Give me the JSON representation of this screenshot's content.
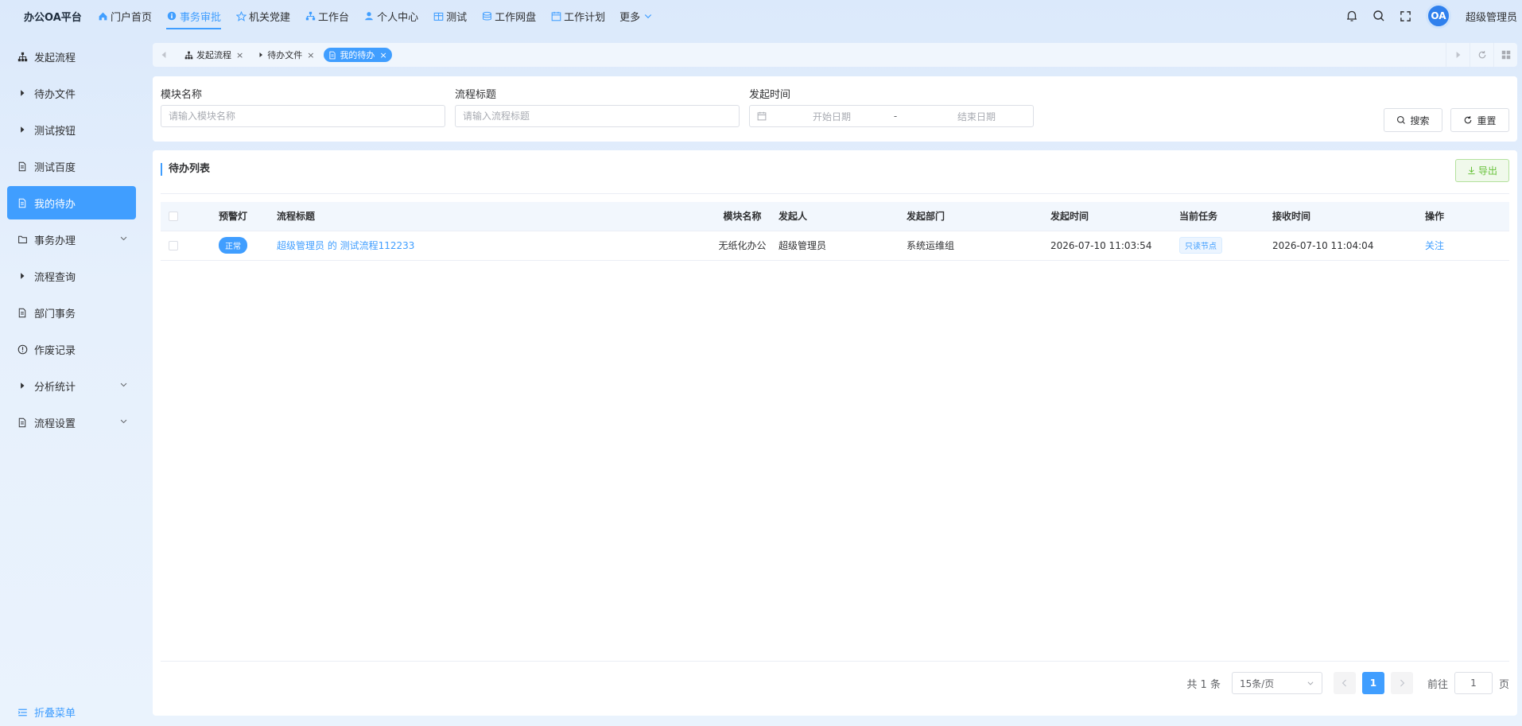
{
  "app": {
    "brand": "办公OA平台",
    "username": "超级管理员",
    "avatar_text": "OA"
  },
  "topnav": [
    {
      "label": "门户首页",
      "icon": "home-icon"
    },
    {
      "label": "事务审批",
      "icon": "info-icon",
      "active": true
    },
    {
      "label": "机关党建",
      "icon": "star-icon"
    },
    {
      "label": "工作台",
      "icon": "workbench-icon"
    },
    {
      "label": "个人中心",
      "icon": "user-icon"
    },
    {
      "label": "测试",
      "icon": "grid-icon"
    },
    {
      "label": "工作网盘",
      "icon": "database-icon"
    },
    {
      "label": "工作计划",
      "icon": "calendar-icon"
    },
    {
      "label": "更多",
      "icon": "chevron-down-icon"
    }
  ],
  "sidebar": {
    "items": [
      {
        "label": "发起流程",
        "icon": "org-chart-icon"
      },
      {
        "label": "待办文件",
        "icon": "caret-right-icon"
      },
      {
        "label": "测试按钮",
        "icon": "caret-right-icon"
      },
      {
        "label": "测试百度",
        "icon": "document-icon"
      },
      {
        "label": "我的待办",
        "icon": "document-icon",
        "active": true
      },
      {
        "label": "事务办理",
        "icon": "folder-icon",
        "expandable": true
      },
      {
        "label": "流程查询",
        "icon": "caret-right-icon"
      },
      {
        "label": "部门事务",
        "icon": "document-icon"
      },
      {
        "label": "作废记录",
        "icon": "info-circle-icon"
      },
      {
        "label": "分析统计",
        "icon": "caret-right-icon",
        "expandable": true
      },
      {
        "label": "流程设置",
        "icon": "document-icon",
        "expandable": true
      }
    ],
    "collapse_label": "折叠菜单"
  },
  "tabs": [
    {
      "label": "发起流程",
      "icon": "org-chart-icon"
    },
    {
      "label": "待办文件",
      "icon": "caret-right-icon"
    },
    {
      "label": "我的待办",
      "icon": "document-icon",
      "active": true
    }
  ],
  "search": {
    "module_label": "模块名称",
    "module_placeholder": "请输入模块名称",
    "title_label": "流程标题",
    "title_placeholder": "请输入流程标题",
    "time_label": "发起时间",
    "start_placeholder": "开始日期",
    "range_sep": "-",
    "end_placeholder": "结束日期",
    "search_button": "搜索",
    "reset_button": "重置"
  },
  "list": {
    "title": "待办列表",
    "export_button": "导出",
    "columns": [
      "预警灯",
      "流程标题",
      "模块名称",
      "发起人",
      "发起部门",
      "发起时间",
      "当前任务",
      "接收时间",
      "操作"
    ],
    "rows": [
      {
        "warning": "正常",
        "title": "超级管理员 的 测试流程112233",
        "module": "无纸化办公",
        "initiator": "超级管理员",
        "dept": "系统运维组",
        "start_time": "2026-07-10 11:03:54",
        "task": "只读节点",
        "receive_time": "2026-07-10 11:04:04",
        "action": "关注"
      }
    ]
  },
  "pagination": {
    "total": "共 1 条",
    "page_size": "15条/页",
    "current_page": "1",
    "goto_label": "前往",
    "goto_value": "1",
    "page_suffix": "页"
  },
  "colors": {
    "accent": "#409eff",
    "export_green": "#67c23a"
  }
}
